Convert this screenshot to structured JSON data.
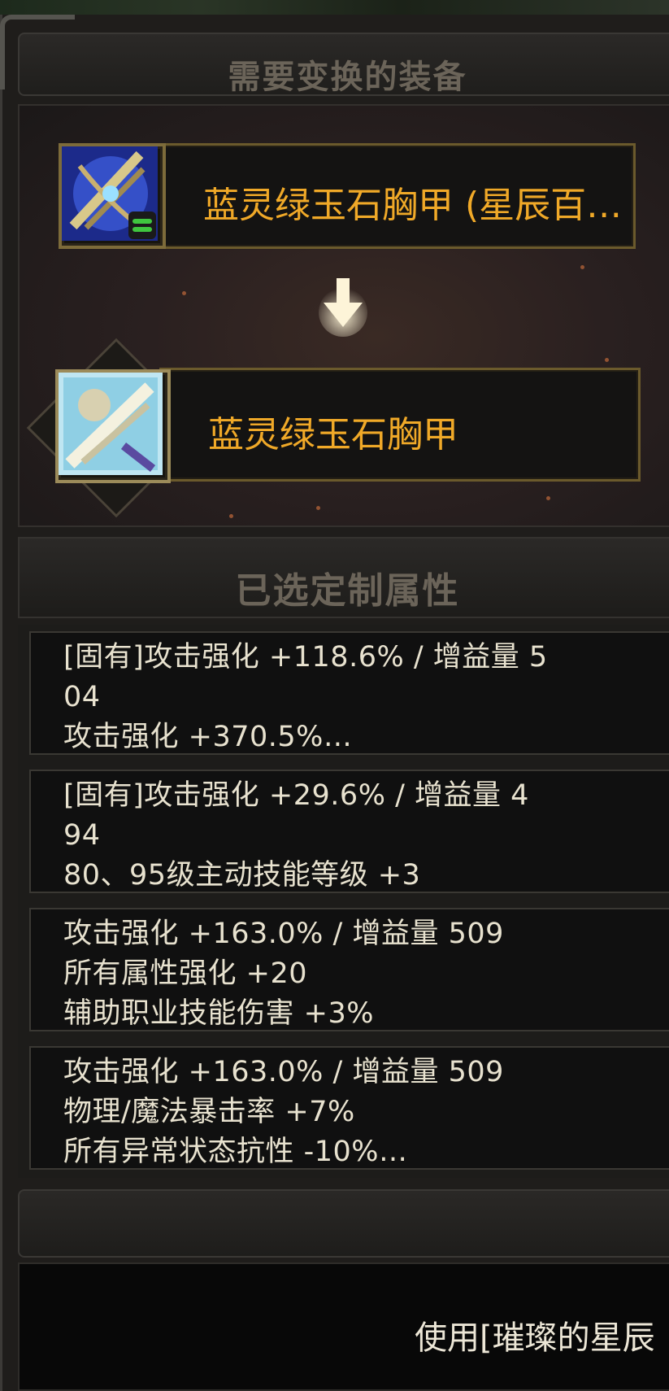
{
  "header": {
    "title": "需要变换的装备"
  },
  "source_item": {
    "name": "蓝灵绿玉石胸甲 (星辰百…"
  },
  "target_item": {
    "name": "蓝灵绿玉石胸甲"
  },
  "attributes": {
    "title": "已选定制属性",
    "rows": [
      [
        "[固有]攻击强化 +118.6% / 增益量 5",
        "04",
        "攻击强化 +370.5%…"
      ],
      [
        "[固有]攻击强化 +29.6% / 增益量 4",
        "94",
        "80、95级主动技能等级 +3"
      ],
      [
        "攻击强化 +163.0% / 增益量 509",
        "所有属性强化 +20",
        "辅助职业技能伤害 +3%"
      ],
      [
        "攻击强化 +163.0% / 增益量 509",
        "物理/魔法暴击率 +7%",
        "所有异常状态抗性 -10%…"
      ]
    ]
  },
  "footer": {
    "message": "使用[璀璨的星辰"
  },
  "icons": {
    "source": "armor-chest-icon",
    "target": "armor-chest-icon",
    "arrow": "arrow-down-icon",
    "badge": "swap-badge-icon"
  },
  "colors": {
    "item_name": "#f0a928",
    "attr_text": "#e8e2cf",
    "title_dim": "#6b6459",
    "frame_gold": "#6b5a2c"
  }
}
